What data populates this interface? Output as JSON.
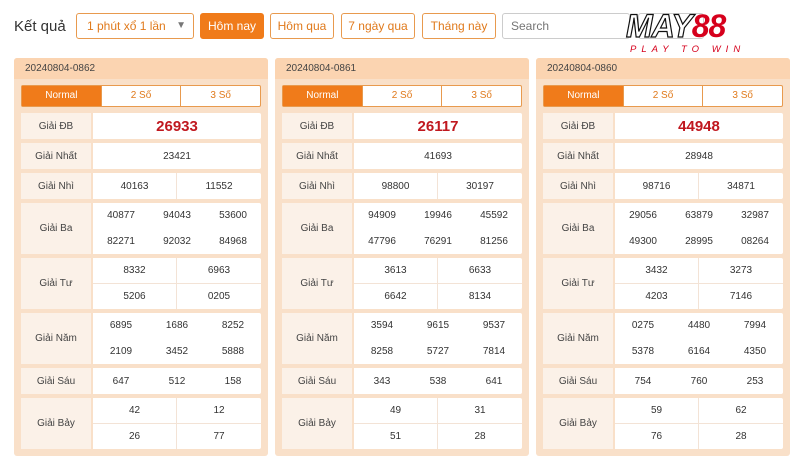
{
  "header": {
    "title": "Kết quả",
    "game_select": "1 phút xổ 1 lần",
    "filters": [
      "Hôm nay",
      "Hôm qua",
      "7 ngày qua",
      "Tháng này"
    ],
    "active_filter": 0,
    "search_placeholder": "Search"
  },
  "logo": {
    "text_black": "MAY",
    "text_red": "88",
    "tagline": "PLAY TO WIN"
  },
  "tabs": [
    "Normal",
    "2 Số",
    "3 Số"
  ],
  "labels": {
    "db": "Giải ĐB",
    "nhat": "Giải Nhất",
    "nhi": "Giải Nhì",
    "ba": "Giải Ba",
    "tu": "Giải Tư",
    "nam": "Giải Năm",
    "sau": "Giải Sáu",
    "bay": "Giải Bảy"
  },
  "panels": [
    {
      "id": "20240804-0862",
      "db": "26933",
      "nhat": "23421",
      "nhi": [
        "40163",
        "11552"
      ],
      "ba": [
        "40877",
        "94043",
        "53600",
        "82271",
        "92032",
        "84968"
      ],
      "tu": [
        "8332",
        "6963",
        "5206",
        "0205"
      ],
      "nam": [
        "6895",
        "1686",
        "8252",
        "2109",
        "3452",
        "5888"
      ],
      "sau": [
        "647",
        "512",
        "158"
      ],
      "bay": [
        "42",
        "12",
        "26",
        "77"
      ]
    },
    {
      "id": "20240804-0861",
      "db": "26117",
      "nhat": "41693",
      "nhi": [
        "98800",
        "30197"
      ],
      "ba": [
        "94909",
        "19946",
        "45592",
        "47796",
        "76291",
        "81256"
      ],
      "tu": [
        "3613",
        "6633",
        "6642",
        "8134"
      ],
      "nam": [
        "3594",
        "9615",
        "9537",
        "8258",
        "5727",
        "7814"
      ],
      "sau": [
        "343",
        "538",
        "641"
      ],
      "bay": [
        "49",
        "31",
        "51",
        "28"
      ]
    },
    {
      "id": "20240804-0860",
      "db": "44948",
      "nhat": "28948",
      "nhi": [
        "98716",
        "34871"
      ],
      "ba": [
        "29056",
        "63879",
        "32987",
        "49300",
        "28995",
        "08264"
      ],
      "tu": [
        "3432",
        "3273",
        "4203",
        "7146"
      ],
      "nam": [
        "0275",
        "4480",
        "7994",
        "5378",
        "6164",
        "4350"
      ],
      "sau": [
        "754",
        "760",
        "253"
      ],
      "bay": [
        "59",
        "62",
        "76",
        "28"
      ]
    }
  ]
}
